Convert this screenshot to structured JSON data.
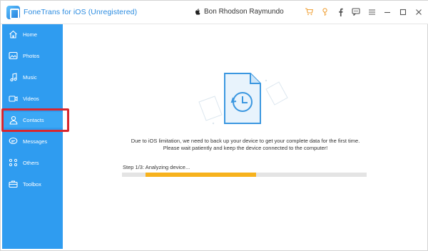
{
  "app": {
    "title": "FoneTrans for iOS (Unregistered)"
  },
  "device": {
    "name": "Bon Rhodson Raymundo",
    "icon": "apple-icon"
  },
  "titlebar_icons": [
    "cart-icon",
    "key-icon",
    "facebook-icon",
    "chat-icon",
    "menu-icon",
    "minimize-icon",
    "maximize-icon",
    "close-icon"
  ],
  "sidebar": {
    "items": [
      {
        "label": "Home",
        "icon": "home-icon"
      },
      {
        "label": "Photos",
        "icon": "photos-icon"
      },
      {
        "label": "Music",
        "icon": "music-icon"
      },
      {
        "label": "Videos",
        "icon": "videos-icon"
      },
      {
        "label": "Contacts",
        "icon": "contacts-icon",
        "active": true
      },
      {
        "label": "Messages",
        "icon": "messages-icon"
      },
      {
        "label": "Others",
        "icon": "others-icon"
      },
      {
        "label": "Toolbox",
        "icon": "toolbox-icon"
      }
    ]
  },
  "main": {
    "message_line1": "Due to iOS limitation, we need to back up your device to get your complete data for the first time.",
    "message_line2": "Please wait patiently and keep the device connected to the computer!",
    "step_text": "Step 1/3: Analyzing device...",
    "progress_fraction": 0.5
  },
  "colors": {
    "sidebar": "#2f9cf0",
    "accent": "#2a8be0",
    "progress": "#f7b21d",
    "highlight": "#d8262f"
  }
}
